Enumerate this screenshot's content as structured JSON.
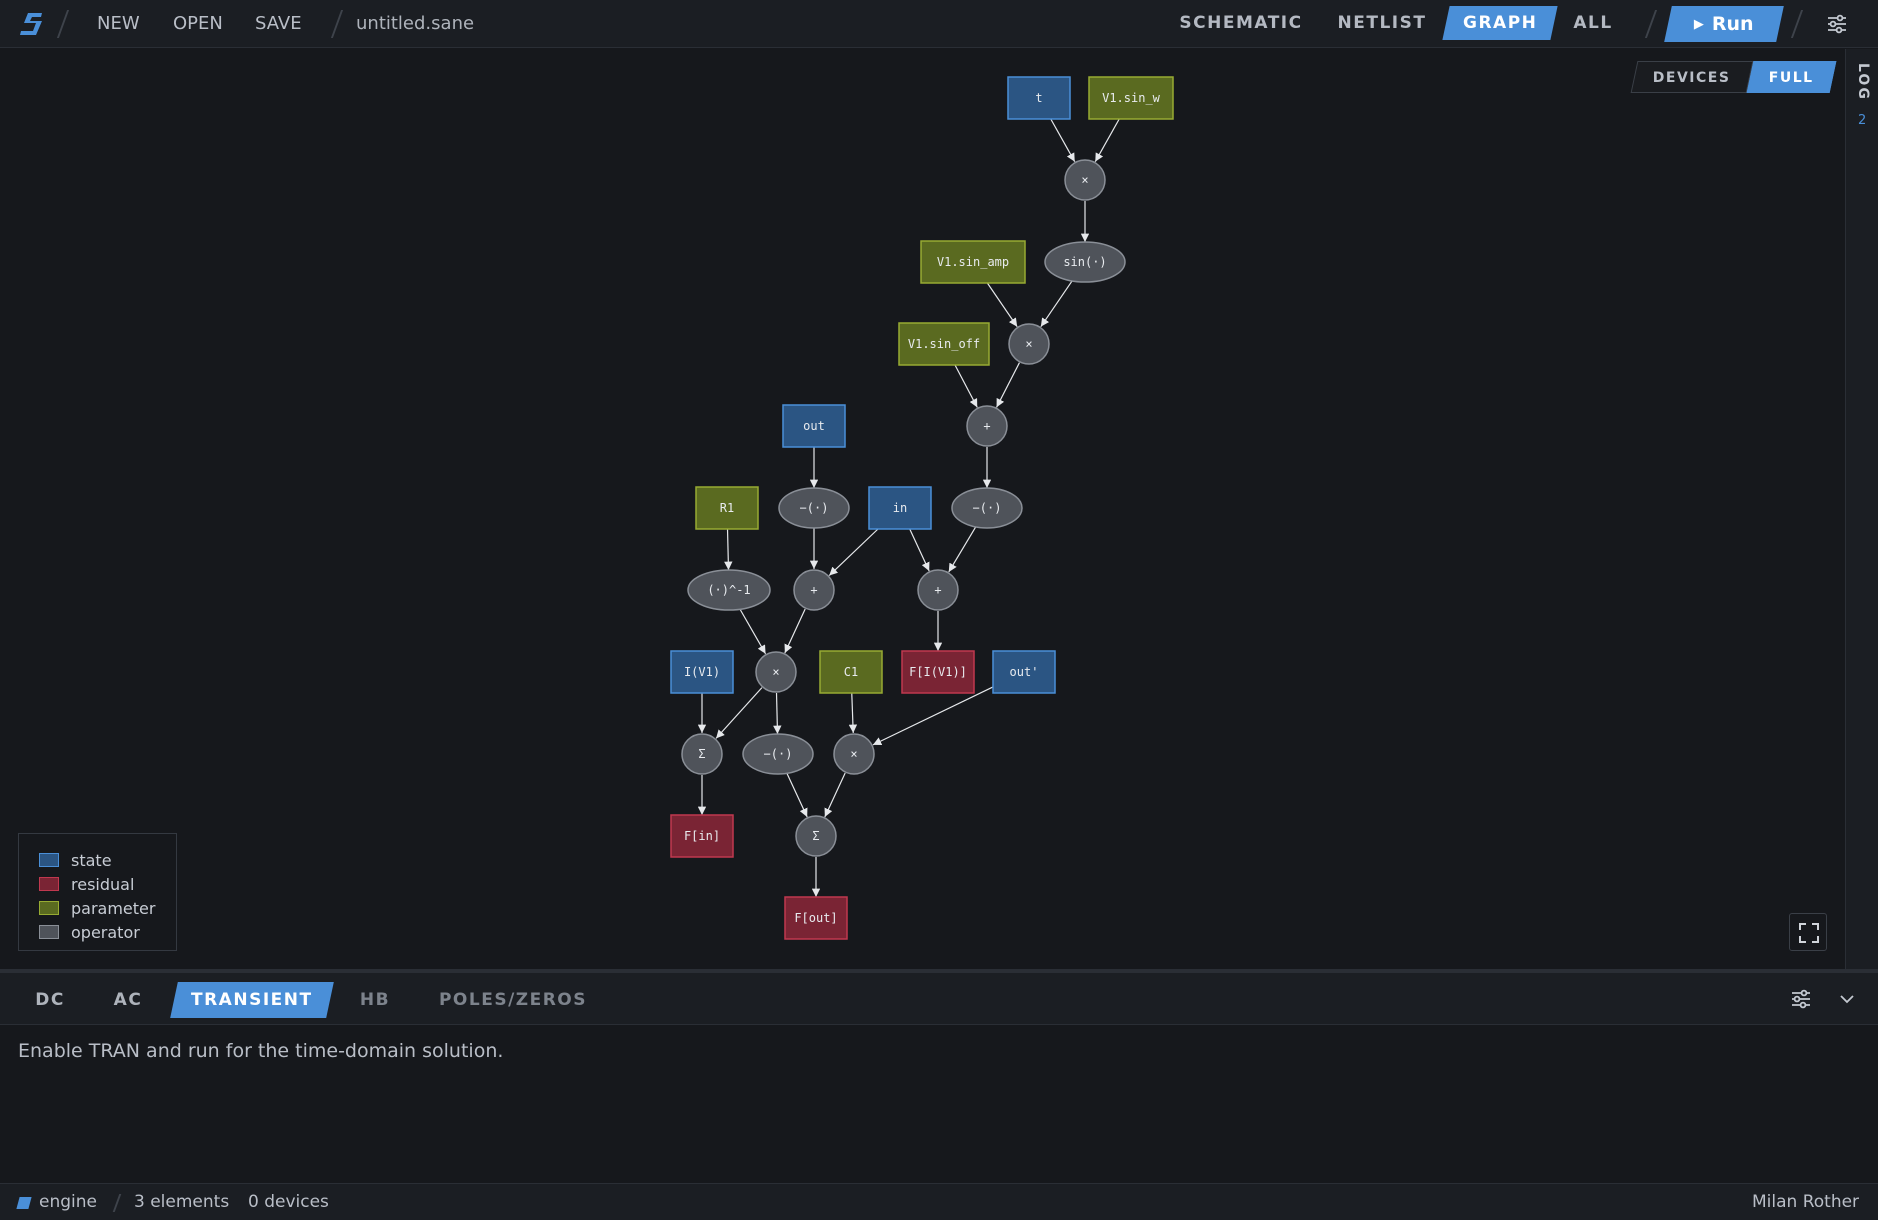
{
  "app": {
    "menu": {
      "new": "NEW",
      "open": "OPEN",
      "save": "SAVE"
    },
    "filename": "untitled.sane",
    "views": [
      "SCHEMATIC",
      "NETLIST",
      "GRAPH",
      "ALL"
    ],
    "active_view": "GRAPH",
    "run_label": "Run",
    "accent_color": "#4a8fd8"
  },
  "graph": {
    "toggle": {
      "devices": "DEVICES",
      "full": "FULL",
      "active": "FULL"
    },
    "colors": {
      "state": {
        "fill": "#2b5583",
        "stroke": "#4a8fd8"
      },
      "residual": {
        "fill": "#7a2434",
        "stroke": "#c0384f"
      },
      "parameter": {
        "fill": "#5a6a20",
        "stroke": "#97ab32"
      },
      "operator": {
        "fill": "#4f535a",
        "stroke": "#8a8f97"
      }
    },
    "legend": [
      {
        "kind": "state",
        "label": "state"
      },
      {
        "kind": "residual",
        "label": "residual"
      },
      {
        "kind": "parameter",
        "label": "parameter"
      },
      {
        "kind": "operator",
        "label": "operator"
      }
    ],
    "nodes": [
      {
        "id": "t",
        "label": "t",
        "kind": "state",
        "shape": "rect"
      },
      {
        "id": "v1sinw",
        "label": "V1.sin_w",
        "kind": "parameter",
        "shape": "rect"
      },
      {
        "id": "mul1",
        "label": "×",
        "kind": "operator",
        "shape": "circle"
      },
      {
        "id": "sin",
        "label": "sin(·)",
        "kind": "operator",
        "shape": "ellipse"
      },
      {
        "id": "v1sinamp",
        "label": "V1.sin_amp",
        "kind": "parameter",
        "shape": "rect"
      },
      {
        "id": "mul2",
        "label": "×",
        "kind": "operator",
        "shape": "circle"
      },
      {
        "id": "v1sinoff",
        "label": "V1.sin_off",
        "kind": "parameter",
        "shape": "rect"
      },
      {
        "id": "add1",
        "label": "+",
        "kind": "operator",
        "shape": "circle"
      },
      {
        "id": "out",
        "label": "out",
        "kind": "state",
        "shape": "rect"
      },
      {
        "id": "r1",
        "label": "R1",
        "kind": "parameter",
        "shape": "rect"
      },
      {
        "id": "neg1",
        "label": "−(·)",
        "kind": "operator",
        "shape": "ellipse"
      },
      {
        "id": "in",
        "label": "in",
        "kind": "state",
        "shape": "rect"
      },
      {
        "id": "neg2",
        "label": "−(·)",
        "kind": "operator",
        "shape": "ellipse"
      },
      {
        "id": "inv",
        "label": "(·)^-1",
        "kind": "operator",
        "shape": "ellipse"
      },
      {
        "id": "add2",
        "label": "+",
        "kind": "operator",
        "shape": "circle"
      },
      {
        "id": "add3",
        "label": "+",
        "kind": "operator",
        "shape": "circle"
      },
      {
        "id": "iv1",
        "label": "I(V1)",
        "kind": "state",
        "shape": "rect"
      },
      {
        "id": "mul3",
        "label": "×",
        "kind": "operator",
        "shape": "circle"
      },
      {
        "id": "c1",
        "label": "C1",
        "kind": "parameter",
        "shape": "rect"
      },
      {
        "id": "fiv1",
        "label": "F[I(V1)]",
        "kind": "residual",
        "shape": "rect"
      },
      {
        "id": "outp",
        "label": "out'",
        "kind": "state",
        "shape": "rect"
      },
      {
        "id": "sum1",
        "label": "Σ",
        "kind": "operator",
        "shape": "circle"
      },
      {
        "id": "neg3",
        "label": "−(·)",
        "kind": "operator",
        "shape": "ellipse"
      },
      {
        "id": "mul4",
        "label": "×",
        "kind": "operator",
        "shape": "circle"
      },
      {
        "id": "fin",
        "label": "F[in]",
        "kind": "residual",
        "shape": "rect"
      },
      {
        "id": "sum2",
        "label": "Σ",
        "kind": "operator",
        "shape": "circle"
      },
      {
        "id": "fout",
        "label": "F[out]",
        "kind": "residual",
        "shape": "rect"
      }
    ],
    "edges": [
      [
        "t",
        "mul1"
      ],
      [
        "v1sinw",
        "mul1"
      ],
      [
        "mul1",
        "sin"
      ],
      [
        "v1sinamp",
        "mul2"
      ],
      [
        "sin",
        "mul2"
      ],
      [
        "v1sinoff",
        "add1"
      ],
      [
        "mul2",
        "add1"
      ],
      [
        "out",
        "neg1"
      ],
      [
        "add1",
        "neg2"
      ],
      [
        "r1",
        "inv"
      ],
      [
        "neg1",
        "add2"
      ],
      [
        "in",
        "add2"
      ],
      [
        "in",
        "add3"
      ],
      [
        "neg2",
        "add3"
      ],
      [
        "inv",
        "mul3"
      ],
      [
        "add2",
        "mul3"
      ],
      [
        "add3",
        "fiv1"
      ],
      [
        "iv1",
        "sum1"
      ],
      [
        "mul3",
        "sum1"
      ],
      [
        "mul3",
        "neg3"
      ],
      [
        "c1",
        "mul4"
      ],
      [
        "outp",
        "mul4"
      ],
      [
        "sum1",
        "fin"
      ],
      [
        "neg3",
        "sum2"
      ],
      [
        "mul4",
        "sum2"
      ],
      [
        "sum2",
        "fout"
      ]
    ],
    "log_label": "LOG",
    "log_count": "2"
  },
  "analysis": {
    "tabs": [
      "DC",
      "AC",
      "TRANSIENT",
      "HB",
      "POLES/ZEROS"
    ],
    "active_tab": "TRANSIENT",
    "message": "Enable TRAN and run for the time-domain solution."
  },
  "status": {
    "engine": "engine",
    "elements": "3 elements",
    "devices": "0 devices",
    "user": "Milan Rother"
  }
}
